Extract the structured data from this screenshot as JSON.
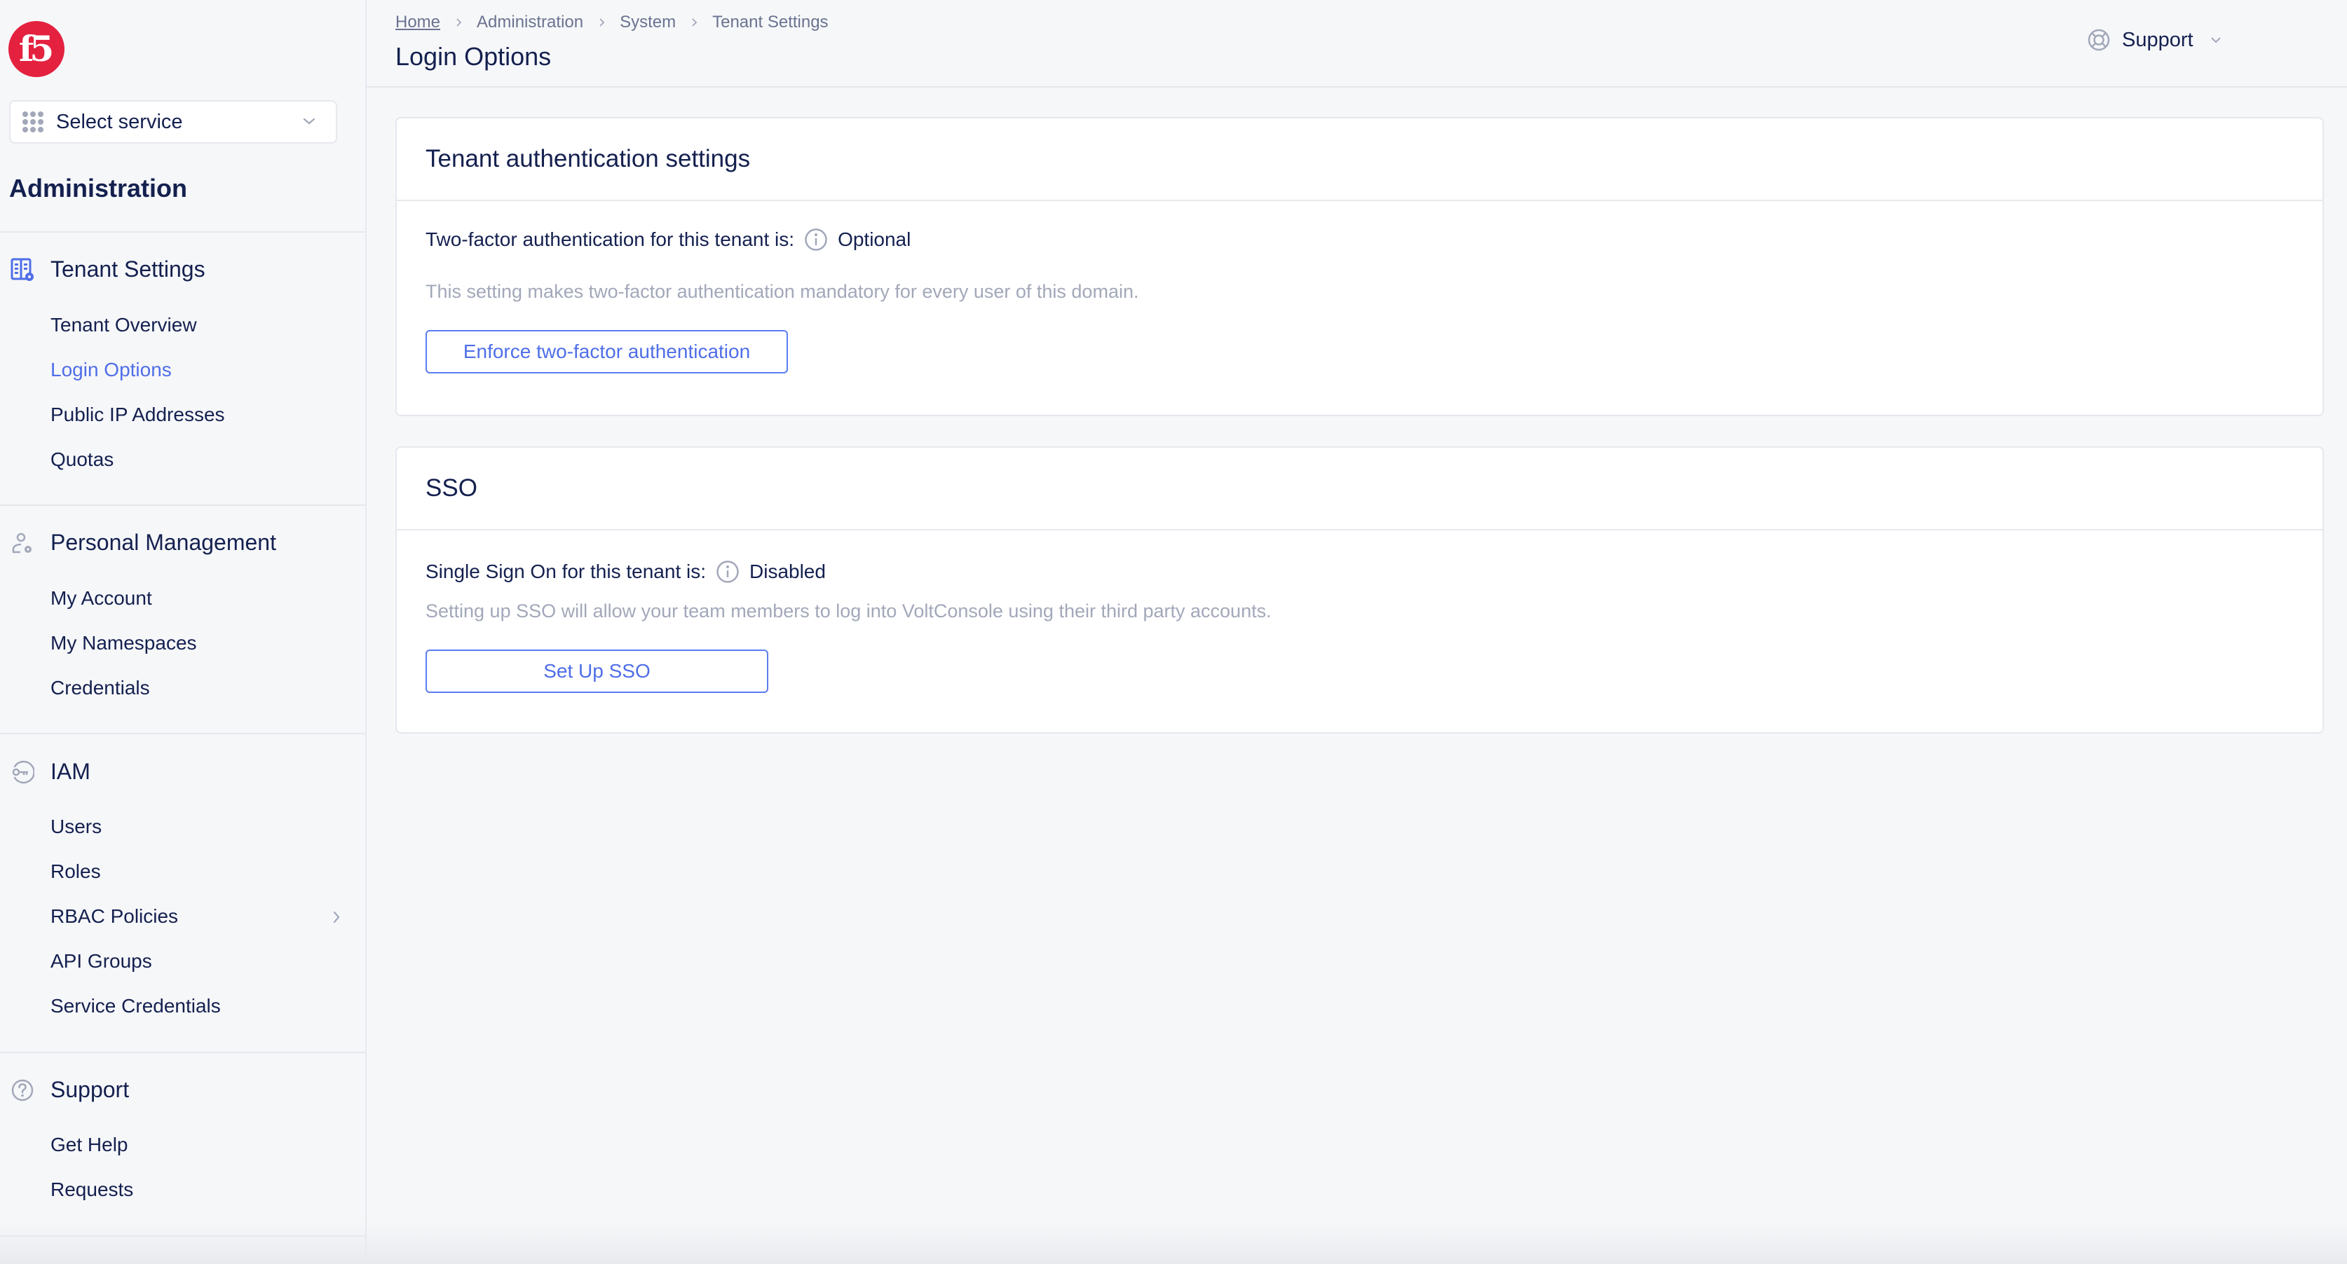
{
  "brand": {
    "logo_text": "f5",
    "logo_color": "#E4213F"
  },
  "sidebar": {
    "service_select": {
      "label": "Select service",
      "icon": "grid-dots-icon"
    },
    "app_title": "Administration",
    "sections": [
      {
        "title": "Tenant Settings",
        "icon": "building-gear-icon",
        "items": [
          {
            "label": "Tenant Overview",
            "active": false
          },
          {
            "label": "Login Options",
            "active": true
          },
          {
            "label": "Public IP Addresses",
            "active": false
          },
          {
            "label": "Quotas",
            "active": false
          }
        ]
      },
      {
        "title": "Personal Management",
        "icon": "user-gear-icon",
        "items": [
          {
            "label": "My Account"
          },
          {
            "label": "My Namespaces"
          },
          {
            "label": "Credentials"
          }
        ]
      },
      {
        "title": "IAM",
        "icon": "key-circle-icon",
        "items": [
          {
            "label": "Users"
          },
          {
            "label": "Roles"
          },
          {
            "label": "RBAC Policies",
            "has_submenu": true
          },
          {
            "label": "API Groups"
          },
          {
            "label": "Service Credentials"
          }
        ]
      },
      {
        "title": "Support",
        "icon": "question-circle-icon",
        "items": [
          {
            "label": "Get Help"
          },
          {
            "label": "Requests"
          }
        ]
      }
    ]
  },
  "header": {
    "breadcrumb": [
      "Home",
      "Administration",
      "System",
      "Tenant Settings"
    ],
    "title": "Login Options",
    "support_menu": {
      "label": "Support",
      "icon": "lifebuoy-icon"
    },
    "user_menu": {
      "icon": "user-avatar-icon"
    }
  },
  "cards": {
    "tenant_auth": {
      "title": "Tenant authentication settings",
      "status_label": "Two-factor authentication for this tenant is:",
      "status_value": "Optional",
      "description": "This setting makes two-factor authentication mandatory for every user of this domain.",
      "button_label": "Enforce two-factor authentication"
    },
    "sso": {
      "title": "SSO",
      "status_label": "Single Sign On for this tenant is:",
      "status_value": "Disabled",
      "description": "Setting up SSO will allow your team members to log into VoltConsole using their third party accounts.",
      "button_label": "Set Up SSO"
    }
  },
  "colors": {
    "accent": "#4F6EE8",
    "text_primary": "#14204F",
    "text_muted": "#A2A8B9",
    "background": "#F6F7F9",
    "border": "#E6E8EE"
  }
}
